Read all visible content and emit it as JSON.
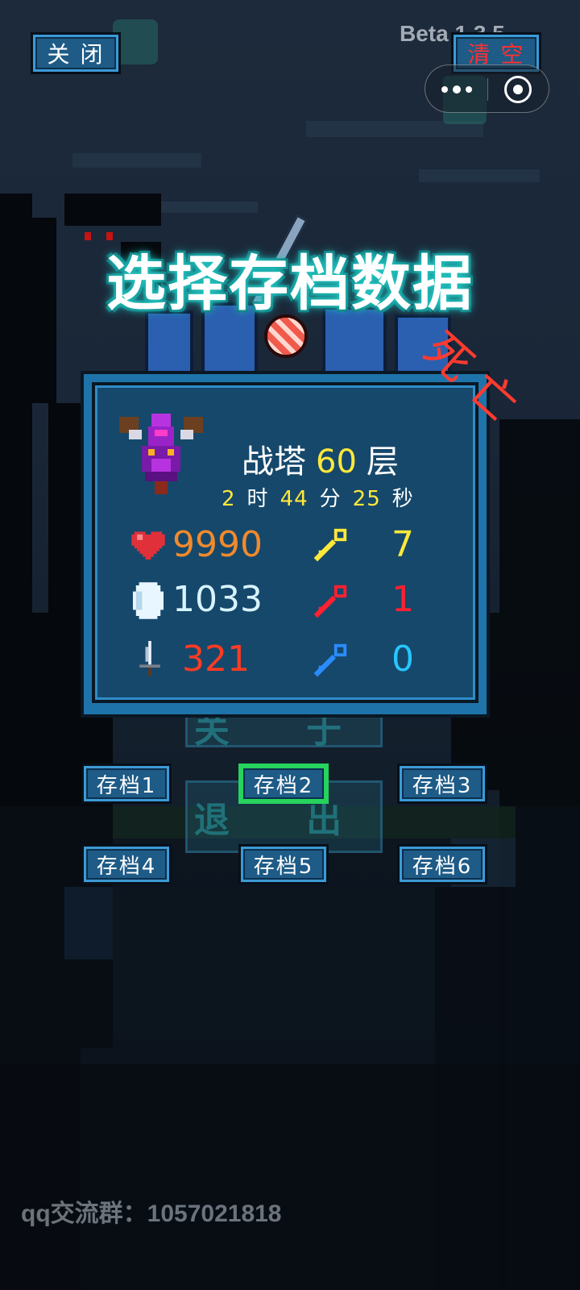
{
  "header": {
    "close_label": "关 闭",
    "clear_label": "清 空",
    "version": "Beta 1.3.5"
  },
  "title": "选择存档数据",
  "status_stamp": "死亡",
  "panel": {
    "floor_prefix": "战塔",
    "floor_number": "60",
    "floor_suffix": "层",
    "time": {
      "hours": "2",
      "h_unit": "时",
      "minutes": "44",
      "m_unit": "分",
      "seconds": "25",
      "s_unit": "秒"
    },
    "stats": {
      "hp": "9990",
      "defense": "1033",
      "attack": "321"
    },
    "keys": {
      "yellow": "7",
      "red": "1",
      "blue": "0"
    }
  },
  "saves": [
    {
      "label": "存档1",
      "selected": false
    },
    {
      "label": "存档2",
      "selected": true
    },
    {
      "label": "存档3",
      "selected": false
    },
    {
      "label": "存档4",
      "selected": false
    },
    {
      "label": "存档5",
      "selected": false
    },
    {
      "label": "存档6",
      "selected": false
    }
  ],
  "background_menu": {
    "option_partial": "关 于",
    "exit_label": "退 出"
  },
  "footer": {
    "qq_group": "qq交流群：1057021818"
  },
  "colors": {
    "hp": "#f08a2c",
    "defense": "#d8f4ff",
    "attack": "#ff3b22",
    "key_yellow": "#ffe83b",
    "key_red": "#ff2030",
    "key_blue": "#27c6ff",
    "title_glow": "#23c7c2",
    "panel": "#16486b"
  }
}
